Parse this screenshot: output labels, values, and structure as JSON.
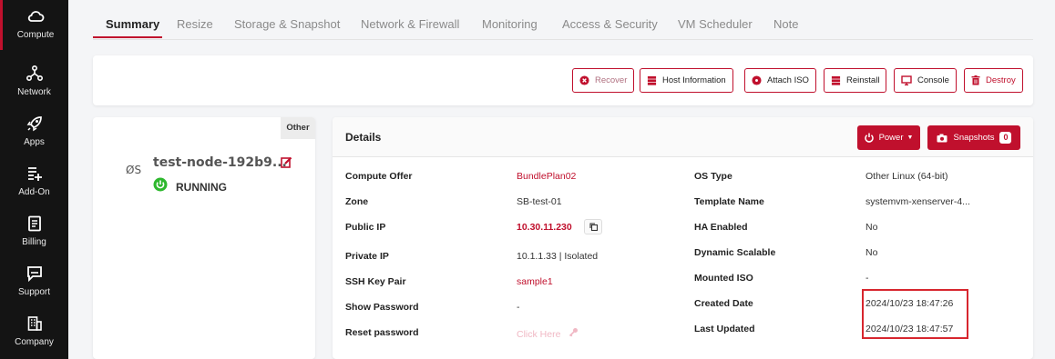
{
  "sidebar": {
    "items": [
      {
        "label": "Compute",
        "icon": "cloud-icon",
        "active": true
      },
      {
        "label": "Network",
        "icon": "network-icon",
        "active": false
      },
      {
        "label": "Apps",
        "icon": "rocket-icon",
        "active": false
      },
      {
        "label": "Add-On",
        "icon": "list-add-icon",
        "active": false
      },
      {
        "label": "Billing",
        "icon": "receipt-icon",
        "active": false
      },
      {
        "label": "Support",
        "icon": "chat-icon",
        "active": false
      },
      {
        "label": "Company",
        "icon": "building-icon",
        "active": false
      }
    ]
  },
  "tabs": [
    "Summary",
    "Resize",
    "Storage & Snapshot",
    "Network & Firewall",
    "Monitoring",
    "Access & Security",
    "VM Scheduler",
    "Note"
  ],
  "toolbar": {
    "recover": "Recover",
    "host_information": "Host Information",
    "attach_iso": "Attach ISO",
    "reinstall": "Reinstall",
    "console": "Console",
    "destroy": "Destroy"
  },
  "vm": {
    "badge": "Other",
    "os_icon": "ØS",
    "name": "test-node-192b9...",
    "status": "RUNNING"
  },
  "details": {
    "title": "Details",
    "power_label": "Power",
    "snapshots_label": "Snapshots",
    "snapshots_count": "0",
    "left": [
      {
        "label": "Compute Offer",
        "value": "BundlePlan02"
      },
      {
        "label": "Zone",
        "value": "SB-test-01"
      },
      {
        "label": "Public IP",
        "value": "10.30.11.230"
      },
      {
        "label": "Private IP",
        "value": "10.1.1.33 | Isolated"
      },
      {
        "label": "SSH Key Pair",
        "value": "sample1"
      },
      {
        "label": "Show Password",
        "value": "-"
      },
      {
        "label": "Reset password",
        "value": "Click Here"
      }
    ],
    "right": [
      {
        "label": "OS Type",
        "value": "Other Linux (64-bit)"
      },
      {
        "label": "Template Name",
        "value": "systemvm-xenserver-4..."
      },
      {
        "label": "HA Enabled",
        "value": "No"
      },
      {
        "label": "Dynamic Scalable",
        "value": "No"
      },
      {
        "label": "Mounted ISO",
        "value": "-"
      },
      {
        "label": "Created Date",
        "value": "2024/10/23 18:47:26"
      },
      {
        "label": "Last Updated",
        "value": "2024/10/23 18:47:57"
      }
    ]
  },
  "colors": {
    "accent": "#c0102d",
    "sidebar_bg": "#141414",
    "running_green": "#2eb82e",
    "highlight_red": "#d7262e"
  }
}
